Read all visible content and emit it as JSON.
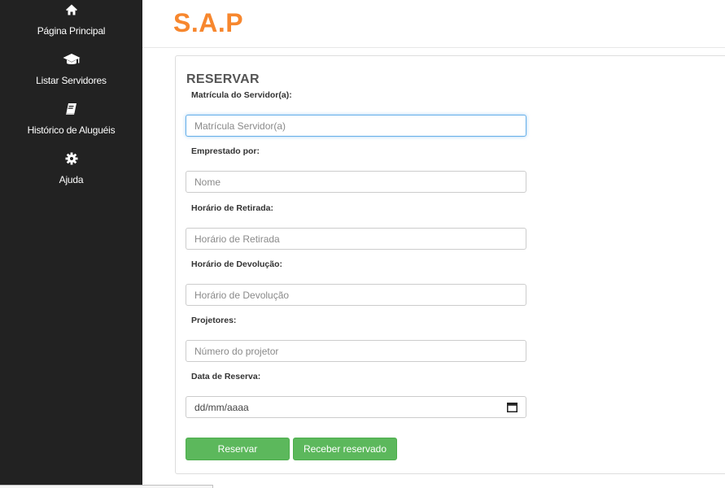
{
  "sidebar": {
    "items": [
      {
        "label": "Página Principal",
        "icon": "home-icon"
      },
      {
        "label": "Listar Servidores",
        "icon": "graduation-cap-icon"
      },
      {
        "label": "Histórico de Aluguéis",
        "icon": "book-icon"
      },
      {
        "label": "Ajuda",
        "icon": "gear-icon"
      }
    ]
  },
  "header": {
    "brand": "S.A.P",
    "brand_color": "#f7872e"
  },
  "form": {
    "title": "RESERVAR",
    "fields": [
      {
        "label": "Matrícula do Servidor(a):",
        "placeholder": "Matrícula Servidor(a)",
        "value": ""
      },
      {
        "label": "Emprestado por:",
        "placeholder": "Nome",
        "value": ""
      },
      {
        "label": "Horário de Retirada:",
        "placeholder": "Horário de Retirada",
        "value": ""
      },
      {
        "label": "Horário de Devolução:",
        "placeholder": "Horário de Devolução",
        "value": ""
      },
      {
        "label": "Projetores:",
        "placeholder": "Número do projetor",
        "value": ""
      },
      {
        "label": "Data de Reserva:",
        "placeholder": "dd/mm/aaaa",
        "value": ""
      }
    ],
    "buttons": {
      "reserve": "Reservar",
      "receive": "Receber reservado"
    },
    "button_color": "#5cb85c"
  }
}
